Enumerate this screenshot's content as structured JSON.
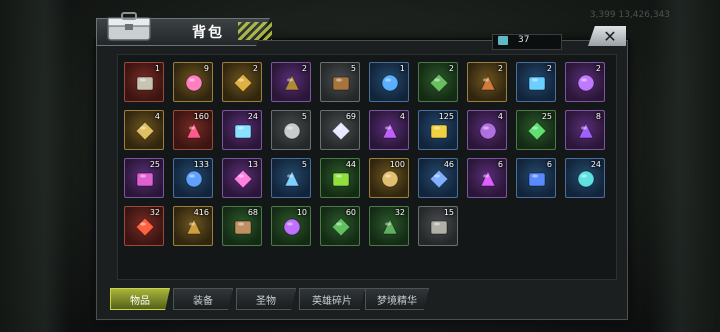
{
  "window": {
    "title": "背包",
    "item_count": "37",
    "close_label": "✕"
  },
  "background": {
    "status_text": "3,399   13,426,343"
  },
  "tabs": [
    {
      "label": "物品",
      "active": true
    },
    {
      "label": "装备",
      "active": false
    },
    {
      "label": "圣物",
      "active": false
    },
    {
      "label": "英雄碎片",
      "active": false
    },
    {
      "label": "梦境精华",
      "active": false
    }
  ],
  "items": [
    {
      "name": "hammer-icon",
      "qty": "1",
      "quality": "red"
    },
    {
      "name": "pink-blob-icon",
      "qty": "9",
      "quality": "gold"
    },
    {
      "name": "gold-pumpkin-icon",
      "qty": "2",
      "quality": "gold"
    },
    {
      "name": "treasure-chest-icon",
      "qty": "2",
      "quality": "purple"
    },
    {
      "name": "wooden-crate-icon",
      "qty": "5",
      "quality": "grey"
    },
    {
      "name": "blue-chest-icon",
      "qty": "1",
      "quality": "blue"
    },
    {
      "name": "green-chest-icon",
      "qty": "2",
      "quality": "green"
    },
    {
      "name": "bronze-chest-icon",
      "qty": "2",
      "quality": "gold"
    },
    {
      "name": "triangle-box-blue-icon",
      "qty": "2",
      "quality": "blue"
    },
    {
      "name": "triangle-box-purple-icon",
      "qty": "2",
      "quality": "purple"
    },
    {
      "name": "24h-card-icon",
      "qty": "4",
      "quality": "gold"
    },
    {
      "name": "pink-candy-icon",
      "qty": "160",
      "quality": "red"
    },
    {
      "name": "octopus-icon",
      "qty": "24",
      "quality": "purple"
    },
    {
      "name": "silver-coin-icon",
      "qty": "5",
      "quality": "grey"
    },
    {
      "name": "white-feather-icon",
      "qty": "69",
      "quality": "grey"
    },
    {
      "name": "purple-feather-icon",
      "qty": "4",
      "quality": "purple"
    },
    {
      "name": "cocktail-icon",
      "qty": "125",
      "quality": "blue"
    },
    {
      "name": "purple-cube-icon",
      "qty": "4",
      "quality": "purple"
    },
    {
      "name": "clover-icon",
      "qty": "25",
      "quality": "green"
    },
    {
      "name": "purple-crystal-icon",
      "qty": "8",
      "quality": "purple"
    },
    {
      "name": "robot-toy-icon",
      "qty": "25",
      "quality": "purple"
    },
    {
      "name": "spinning-top-icon",
      "qty": "133",
      "quality": "blue"
    },
    {
      "name": "pink-pill-icon",
      "qty": "13",
      "quality": "purple"
    },
    {
      "name": "badge-shield-icon",
      "qty": "5",
      "quality": "blue"
    },
    {
      "name": "green-slime-icon",
      "qty": "44",
      "quality": "green"
    },
    {
      "name": "key-icon",
      "qty": "100",
      "quality": "gold"
    },
    {
      "name": "blue-ticket-icon",
      "qty": "46",
      "quality": "blue"
    },
    {
      "name": "syringe-icon",
      "qty": "6",
      "quality": "purple"
    },
    {
      "name": "blue-card-icon",
      "qty": "6",
      "quality": "blue"
    },
    {
      "name": "bottle-cap-icon",
      "qty": "24",
      "quality": "blue"
    },
    {
      "name": "poker-chip-icon",
      "qty": "32",
      "quality": "red"
    },
    {
      "name": "bullet-icon",
      "qty": "416",
      "quality": "gold"
    },
    {
      "name": "bread-icon",
      "qty": "68",
      "quality": "green"
    },
    {
      "name": "purple-gadget-icon",
      "qty": "10",
      "quality": "green"
    },
    {
      "name": "green-cap-icon",
      "qty": "60",
      "quality": "green"
    },
    {
      "name": "green-leaf-icon",
      "qty": "32",
      "quality": "green"
    },
    {
      "name": "grey-stone-icon",
      "qty": "15",
      "quality": "grey"
    }
  ],
  "quality_colors": {
    "red": "#9a4a3c",
    "gold": "#9a8040",
    "purple": "#7a56a0",
    "blue": "#4a6e9a",
    "green": "#4a7a48",
    "grey": "#6a7072"
  },
  "glyph_colors": {
    "hammer-icon": "#c9c3b4",
    "pink-blob-icon": "#ff7fc0",
    "gold-pumpkin-icon": "#e0b040",
    "treasure-chest-icon": "#b08a3c",
    "wooden-crate-icon": "#a8743c",
    "blue-chest-icon": "#5ab0ff",
    "green-chest-icon": "#6ac060",
    "bronze-chest-icon": "#d07a3c",
    "triangle-box-blue-icon": "#6ad0ff",
    "triangle-box-purple-icon": "#c07aff",
    "24h-card-icon": "#e0c060",
    "pink-candy-icon": "#ff5a8a",
    "octopus-icon": "#8ae0ff",
    "silver-coin-icon": "#c8cccc",
    "white-feather-icon": "#e8e8ff",
    "purple-feather-icon": "#c060ff",
    "cocktail-icon": "#f0d040",
    "purple-cube-icon": "#b070e0",
    "clover-icon": "#60e070",
    "purple-crystal-icon": "#a060ff",
    "robot-toy-icon": "#e060d0",
    "spinning-top-icon": "#60a0ff",
    "pink-pill-icon": "#ff80e0",
    "badge-shield-icon": "#80d0ff",
    "green-slime-icon": "#90e040",
    "key-icon": "#e0c070",
    "blue-ticket-icon": "#80b0ff",
    "syringe-icon": "#e060ff",
    "blue-card-icon": "#5a8aff",
    "bottle-cap-icon": "#60e0e0",
    "poker-chip-icon": "#ff6040",
    "bullet-icon": "#d0a040",
    "bread-icon": "#c09060",
    "purple-gadget-icon": "#c070ff",
    "green-cap-icon": "#60c060",
    "green-leaf-icon": "#60b060",
    "grey-stone-icon": "#b0b0a8"
  }
}
